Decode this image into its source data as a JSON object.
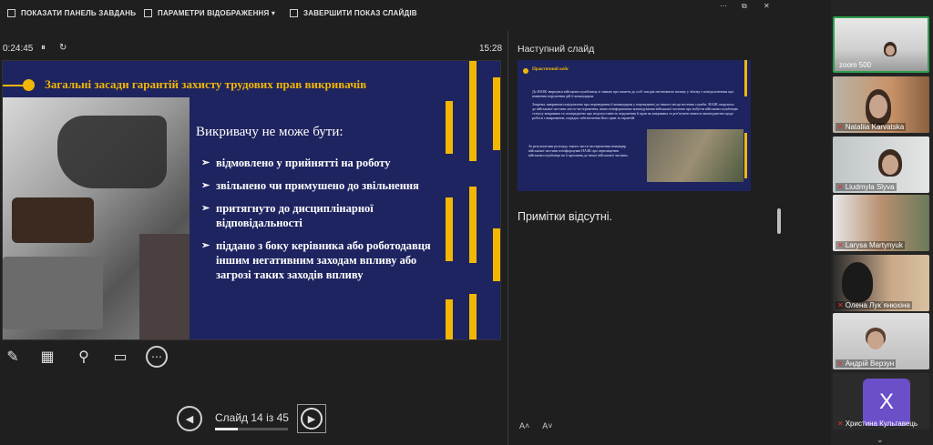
{
  "toolbar": {
    "show_taskbar": "ПОКАЗАТИ ПАНЕЛЬ ЗАВДАНЬ",
    "display_settings": "ПАРАМЕТРИ ВІДОБРАЖЕННЯ ▾",
    "end_show": "ЗАВЕРШИТИ ПОКАЗ СЛАЙДІВ"
  },
  "window": {
    "restore": "⧉",
    "close": "✕",
    "more": "⋯"
  },
  "presenter": {
    "elapsed": "0:24:45",
    "pause": "⏸",
    "reset": "↻",
    "clock": "15:28"
  },
  "slide": {
    "title": "Загальні засади гарантій захисту трудових прав викривачів",
    "subtitle": "Викривачу не може бути:",
    "bullets": [
      "відмовлено у прийнятті на роботу",
      "звільнено чи примушено до звільнення",
      "притягнуто до дисциплінарної відповідальності",
      "піддано з боку керівника або роботодавця іншим негативним заходам впливу або загрозі таких заходів впливу"
    ],
    "accent": "#f2b705",
    "bg": "#1e2460"
  },
  "tools": {
    "pen": "✎",
    "grid": "▦",
    "zoom": "⚲",
    "screen": "▭",
    "more": "⋯"
  },
  "navigation": {
    "prev": "◀",
    "label": "Слайд 14 із 45",
    "next": "▶",
    "current": 14,
    "total": 45
  },
  "next_slide": {
    "label": "Наступний слайд",
    "mini_title": "Практичний кейс",
    "mini_p1": "До НАЗК звернувся військовослужбовець зі заявою про вжиття до осіб заходів негативного впливу у зв'язку з повідомленням про вчинення порушення дій її командиром.",
    "mini_p2": "Зокрема, викривача повідомлено про переведення її командиром у переведенні до іншого місця несення служби. НАЗК скерувало до військової частини листа-застереження, яким поінформовано командування військової частини про набуття військовослужбовцю статусу викривача та попереджено про недопустимість порушення її прав як викривача та роз'яснено вимоги законодавства щодо роботи з викривачем, порядок забезпечення його прав та гарантій.",
    "mini_p3": "За результатами розгляду такого листа-застереження командир військової частини поінформував НАЗК про переміщення військовослужбовця на її прохання до іншої військової частини."
  },
  "notes": {
    "text": "Примітки відсутні."
  },
  "font_buttons": {
    "increase": "A˄",
    "decrease": "A˅"
  },
  "participants": [
    {
      "name": "zoom 500"
    },
    {
      "name": "Nataliia Karvatska"
    },
    {
      "name": "Liudmyla Slyva"
    },
    {
      "name": "Larysa Martynyuk"
    },
    {
      "name": "Олена Лук`янюхіна"
    },
    {
      "name": "Андрій Верзун"
    },
    {
      "name": "Христина Кульгавець",
      "initial": "X"
    }
  ]
}
